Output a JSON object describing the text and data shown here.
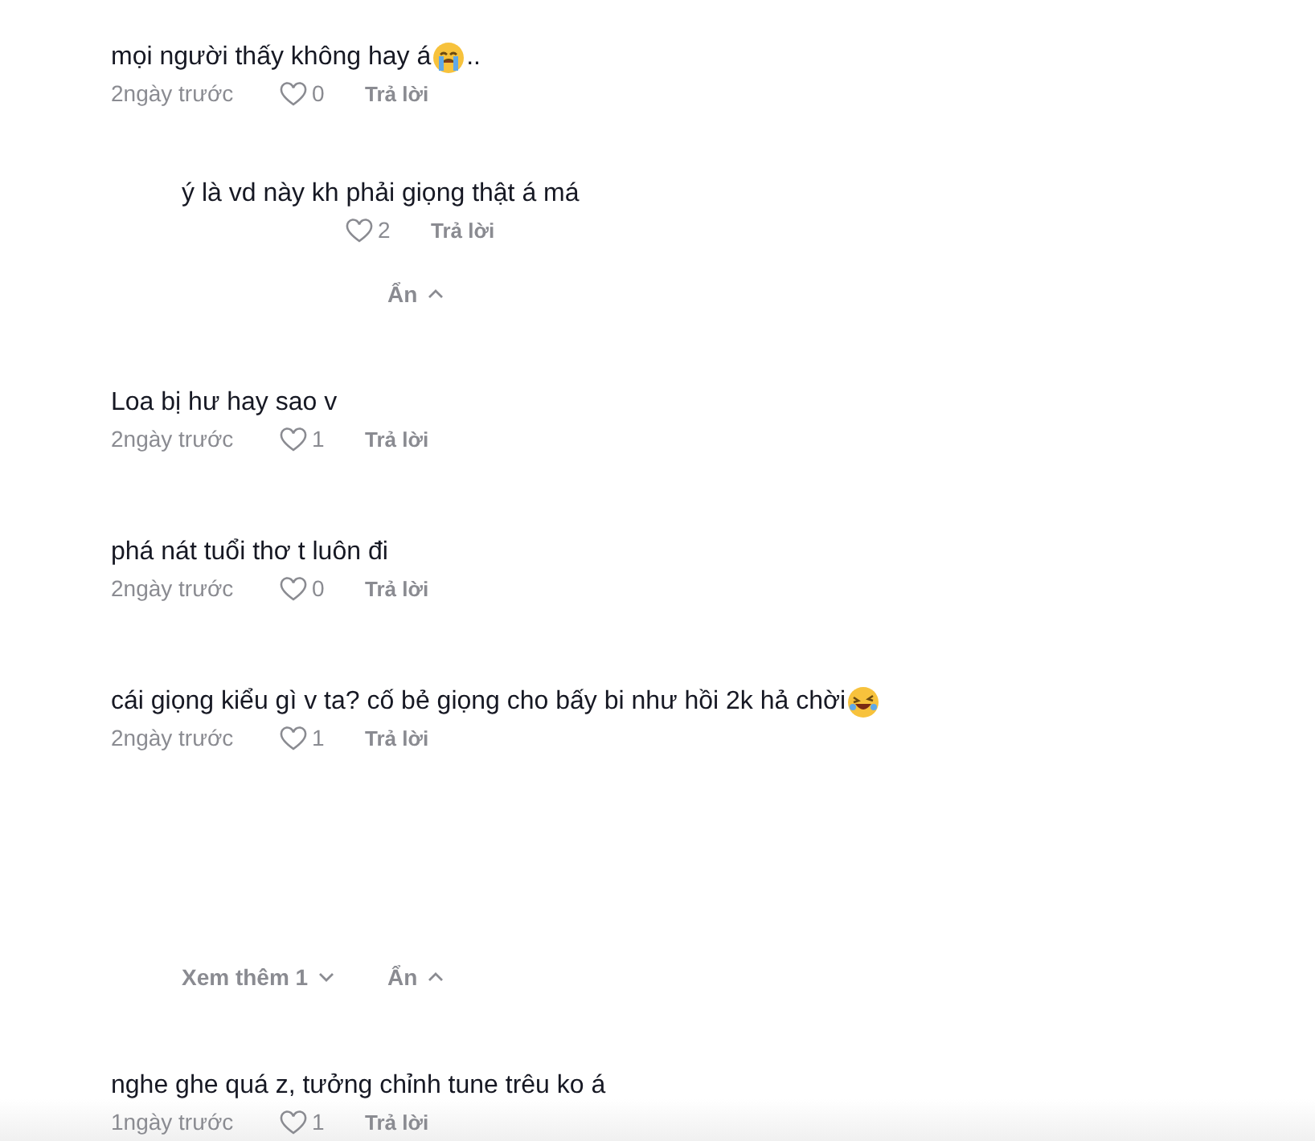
{
  "items": [
    {
      "kind": "comment",
      "text": "mọi người thấy không hay á",
      "emoji": {
        "kind": "crying"
      },
      "text_after": "..",
      "time": "2ngày trước",
      "likes": "0",
      "reply": "Trả lời"
    },
    {
      "kind": "reply",
      "text": "ý là vd này kh phải giọng thật á má",
      "likes": "2",
      "reply": "Trả lời"
    },
    {
      "kind": "controls",
      "hide": "Ẩn"
    },
    {
      "kind": "comment",
      "text": "Loa bị hư hay sao v",
      "time": "2ngày trước",
      "likes": "1",
      "reply": "Trả lời"
    },
    {
      "kind": "comment",
      "text": "phá nát tuổi thơ t luôn đi",
      "time": "2ngày trước",
      "likes": "0",
      "reply": "Trả lời"
    },
    {
      "kind": "comment",
      "text": "cái giọng kiểu gì v ta? cố bẻ giọng cho bấy bi như hồi 2k hả chời ",
      "emoji": {
        "kind": "laughing"
      },
      "time": "2ngày trước",
      "likes": "1",
      "reply": "Trả lời"
    },
    {
      "kind": "controls",
      "more": "Xem thêm 1",
      "hide": "Ẩn"
    },
    {
      "kind": "comment",
      "text": "nghe ghe quá z, tưởng chỉnh tune trêu ko á",
      "time": "1ngày trước",
      "likes": "1",
      "reply": "Trả lời"
    }
  ]
}
